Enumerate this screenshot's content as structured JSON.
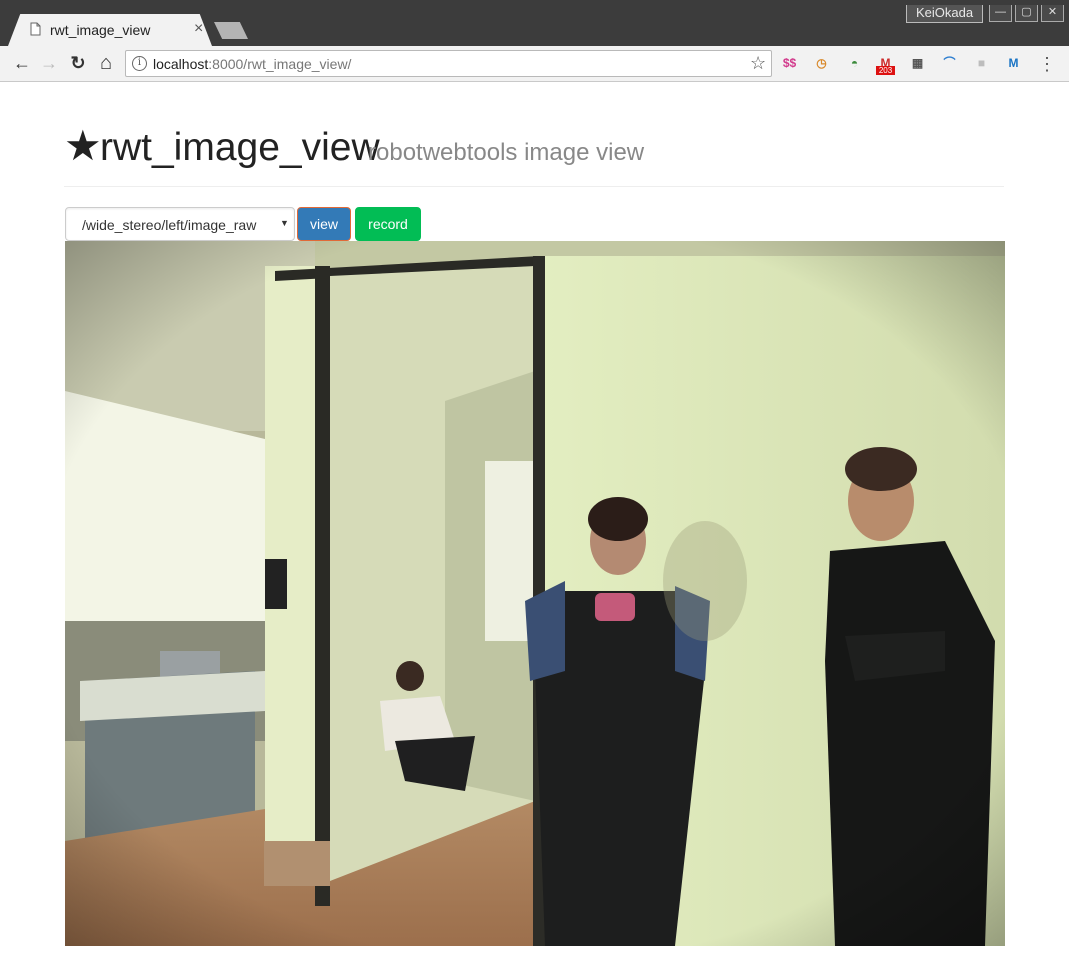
{
  "browser": {
    "tab": {
      "title": "rwt_image_view",
      "close_glyph": "×"
    },
    "profile_name": "KeiOkada",
    "window_buttons": [
      "—",
      "▢",
      "✕"
    ],
    "nav": {
      "back": "←",
      "forward": "→",
      "reload": "↻",
      "home": "⌂"
    },
    "address": {
      "host": "localhost",
      "rest": ":8000/rwt_image_view/"
    },
    "bookmark_glyph": "☆",
    "extensions": [
      {
        "name": "translate-ext-icon",
        "glyph": "$$",
        "color": "#d23a8c"
      },
      {
        "name": "clock-ext-icon",
        "glyph": "◷",
        "color": "#d98a2c"
      },
      {
        "name": "rainbow-ext-icon",
        "glyph": "◓",
        "color": "#3a8a3a"
      },
      {
        "name": "gmail-ext-icon",
        "glyph": "M",
        "color": "#cc2a2a",
        "badge": "203"
      },
      {
        "name": "calendar-ext-icon",
        "glyph": "▦",
        "color": "#555555"
      },
      {
        "name": "arc-ext-icon",
        "glyph": "⌒",
        "color": "#2f7fd0"
      },
      {
        "name": "grey-ext-icon",
        "glyph": "■",
        "color": "#bdbdbd"
      },
      {
        "name": "m-ext-icon",
        "glyph": "M",
        "color": "#1a74c4"
      }
    ],
    "menu_glyph": "⋮"
  },
  "page": {
    "star_glyph": "★",
    "title": "rwt_image_view",
    "subtitle": "robotwebtools image view",
    "topic_select": {
      "value": "/wide_stereo/left/image_raw",
      "caret": "▼"
    },
    "view_button": "view",
    "record_button": "record"
  },
  "colors": {
    "view_button": "#337ab7",
    "record_button": "#02bd55",
    "title_bar": "#3c3c3c"
  }
}
